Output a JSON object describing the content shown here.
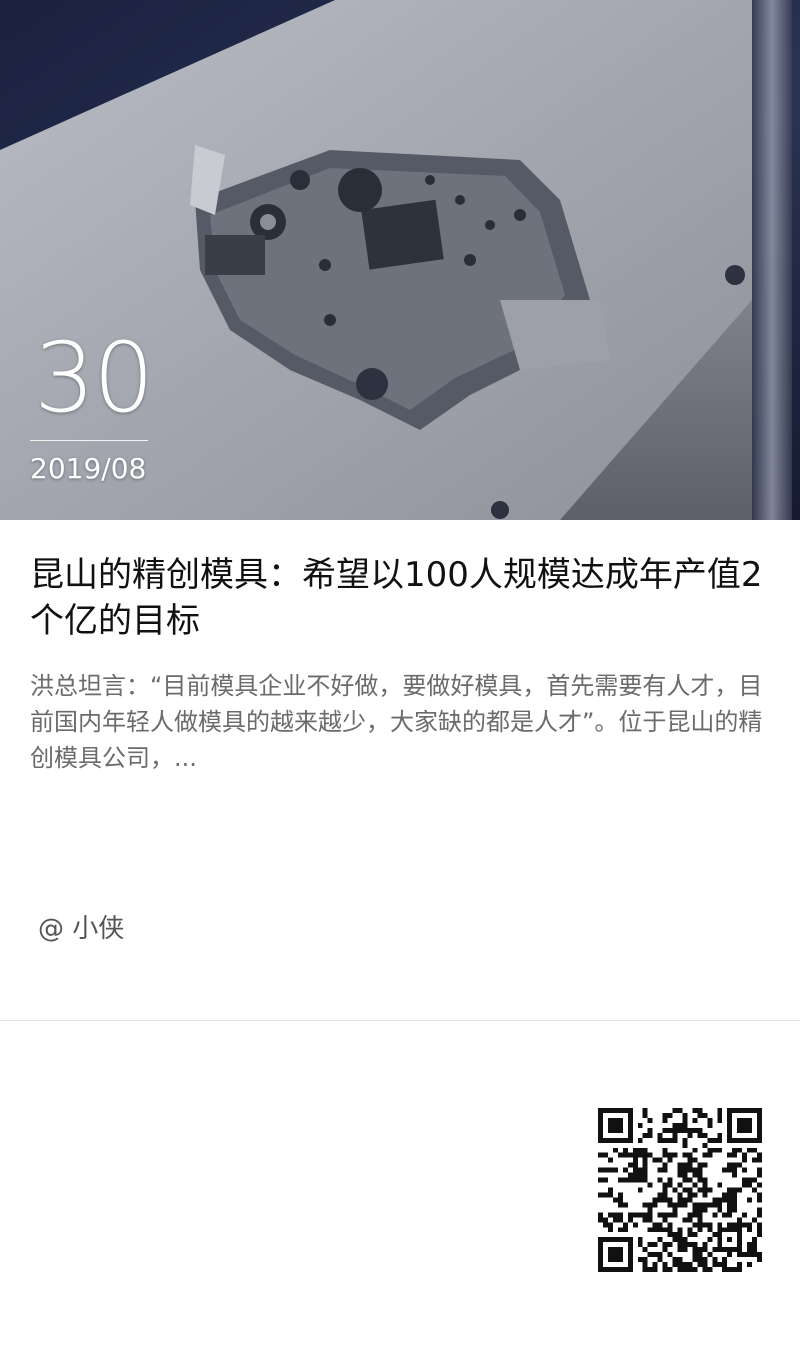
{
  "hero": {
    "day": "30",
    "year_month": "2019/08"
  },
  "article": {
    "title": "昆山的精创模具：希望以100人规模达成年产值2个亿的目标",
    "summary": "洪总坦言：“目前模具企业不好做，要做好模具，首先需要有人才，目前国内年轻人做模具的越来越少，大家缺的都是人才”。位于昆山的精创模具公司，...",
    "author": "@ 小侠"
  },
  "colors": {
    "background": "#ffffff",
    "title": "#111111",
    "summary": "#6b6b6b",
    "author": "#555555",
    "divider": "#e6e6e6"
  },
  "icons": {
    "qr": "qr-code-icon"
  }
}
